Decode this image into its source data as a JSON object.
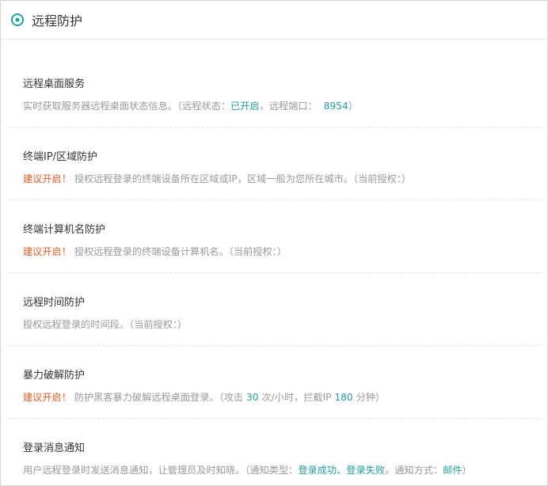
{
  "header": {
    "title": "远程防护"
  },
  "items": [
    {
      "title": "远程桌面服务",
      "desc_prefix": "实时获取服务器远程桌面状态信息。（远程状态：",
      "status": "已开启",
      "desc_mid": "，远程端口：",
      "port": "8954",
      "desc_suffix": "）"
    },
    {
      "title": "终端IP/区域防护",
      "warn": "建议开启！",
      "desc": "授权远程登录的终端设备所在区域或IP，区域一般为您所在城市。（当前授权：）"
    },
    {
      "title": "终端计算机名防护",
      "warn": "建议开启！",
      "desc": "授权远程登录的终端设备计算机名。（当前授权：）"
    },
    {
      "title": "远程时间防护",
      "desc": "授权远程登录的时间段。（当前授权：）"
    },
    {
      "title": "暴力破解防护",
      "warn": "建议开启！",
      "desc_prefix": "防护黑客暴力破解远程桌面登录。（攻击",
      "attack_count": "30",
      "desc_mid": "次/小时，拦截IP",
      "block_minutes": "180",
      "desc_suffix": "分钟）"
    },
    {
      "title": "登录消息通知",
      "desc_prefix": "用户远程登录时发送消息通知，让管理员及时知晓。（通知类型：",
      "type_success": "登录成功",
      "sep": "、",
      "type_fail": "登录失败",
      "desc_mid": "，通知方式：",
      "method": "邮件",
      "desc_suffix": "）"
    }
  ],
  "colors": {
    "accent": "#20a0a0",
    "warning": "#ef5b1e",
    "muted": "#999999",
    "title": "#333333"
  }
}
